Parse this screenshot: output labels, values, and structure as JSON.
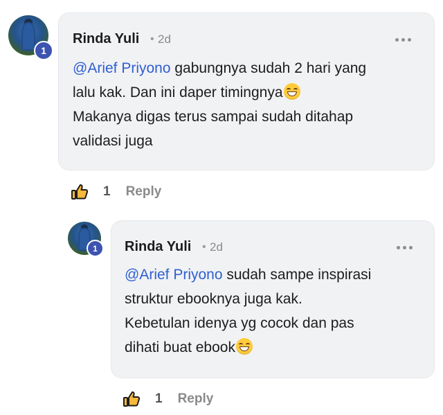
{
  "comments": [
    {
      "author": "Rinda Yuli",
      "separator": "•",
      "time": "2d",
      "badge": "1",
      "mention": "@Arief Priyono",
      "text_lines": [
        " gabungnya sudah 2 hari yang",
        "lalu kak. Dan ini daper timingnya",
        "Makanya digas terus sampai sudah ditahap",
        "validasi juga"
      ],
      "emoji": "grinning-face",
      "like_count": "1",
      "reply_label": "Reply"
    },
    {
      "author": "Rinda Yuli",
      "separator": "•",
      "time": "2d",
      "badge": "1",
      "mention": "@Arief Priyono",
      "text_lines": [
        " sudah sampe inspirasi",
        "struktur ebooknya juga kak.",
        "Kebetulan idenya yg cocok dan pas",
        "dihati buat ebook"
      ],
      "emoji": "grinning-face",
      "like_count": "1",
      "reply_label": "Reply"
    }
  ],
  "icons": {
    "more": "more-horizontal-icon",
    "like": "thumbs-up-icon"
  },
  "colors": {
    "mention": "#2f5fd0",
    "badge": "#3d53b0",
    "bubble": "#f1f2f4"
  }
}
